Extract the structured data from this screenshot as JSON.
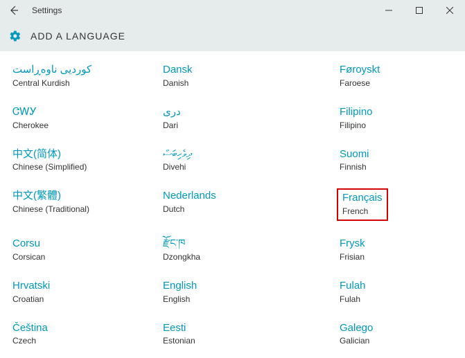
{
  "titlebar": {
    "title": "Settings"
  },
  "header": {
    "page_title": "ADD A LANGUAGE"
  },
  "accent_color": "#0099bc",
  "languages": [
    {
      "native": "کوردیی ناوەڕاست",
      "english": "Central Kurdish",
      "highlighted": false
    },
    {
      "native": "Dansk",
      "english": "Danish",
      "highlighted": false
    },
    {
      "native": "Føroyskt",
      "english": "Faroese",
      "highlighted": false
    },
    {
      "native": "ᏣᎳᎩ",
      "english": "Cherokee",
      "highlighted": false
    },
    {
      "native": "درى",
      "english": "Dari",
      "highlighted": false
    },
    {
      "native": "Filipino",
      "english": "Filipino",
      "highlighted": false
    },
    {
      "native": "中文(简体)",
      "english": "Chinese (Simplified)",
      "highlighted": false
    },
    {
      "native": "ދިވެހިބަސް",
      "english": "Divehi",
      "highlighted": false
    },
    {
      "native": "Suomi",
      "english": "Finnish",
      "highlighted": false
    },
    {
      "native": "中文(繁體)",
      "english": "Chinese (Traditional)",
      "highlighted": false
    },
    {
      "native": "Nederlands",
      "english": "Dutch",
      "highlighted": false
    },
    {
      "native": "Français",
      "english": "French",
      "highlighted": true
    },
    {
      "native": "Corsu",
      "english": "Corsican",
      "highlighted": false
    },
    {
      "native": "རྫོང་ཁ",
      "english": "Dzongkha",
      "highlighted": false
    },
    {
      "native": "Frysk",
      "english": "Frisian",
      "highlighted": false
    },
    {
      "native": "Hrvatski",
      "english": "Croatian",
      "highlighted": false
    },
    {
      "native": "English",
      "english": "English",
      "highlighted": false
    },
    {
      "native": "Fulah",
      "english": "Fulah",
      "highlighted": false
    },
    {
      "native": "Čeština",
      "english": "Czech",
      "highlighted": false
    },
    {
      "native": "Eesti",
      "english": "Estonian",
      "highlighted": false
    },
    {
      "native": "Galego",
      "english": "Galician",
      "highlighted": false
    }
  ]
}
